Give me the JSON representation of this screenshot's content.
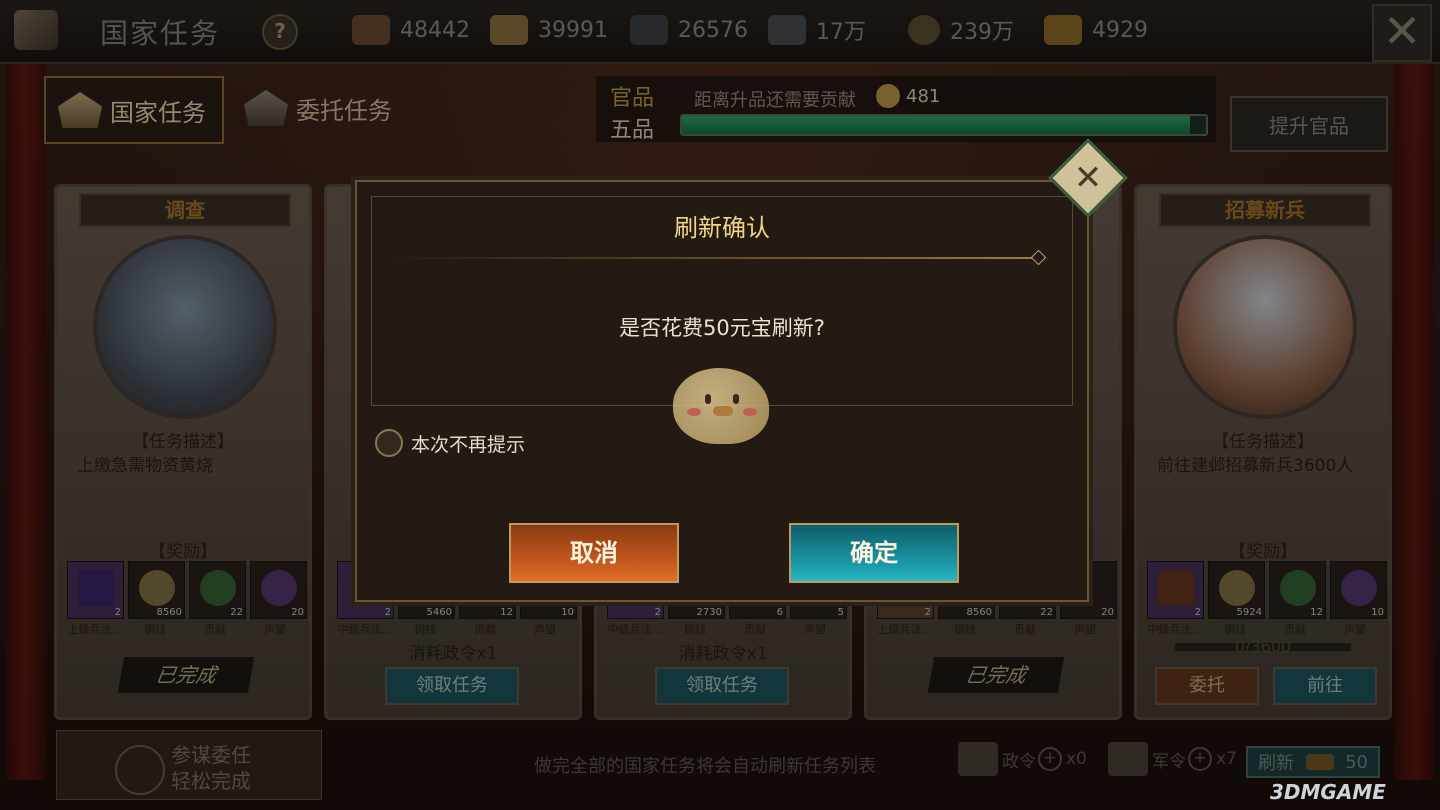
{
  "topbar": {
    "title": "国家任务",
    "help": "?",
    "resources": [
      {
        "icon": "wood-icon",
        "value": "48442"
      },
      {
        "icon": "grain-icon",
        "value": "39991"
      },
      {
        "icon": "iron-icon",
        "value": "26576"
      },
      {
        "icon": "stone-icon",
        "value": "17万"
      },
      {
        "icon": "copper-coin-icon",
        "value": "239万"
      },
      {
        "icon": "gold-ingot-icon",
        "value": "4929"
      }
    ],
    "close": "✕"
  },
  "tabs": [
    {
      "label": "国家任务",
      "active": true
    },
    {
      "label": "委托任务",
      "active": false
    }
  ],
  "rank": {
    "label": "官品",
    "value": "五品",
    "note": "距离升品还需要贡献",
    "remaining": "481",
    "progress": 0.97,
    "promote_label": "提升官品"
  },
  "cards": [
    {
      "title": "调查",
      "desc_header": "【任务描述】",
      "desc": "上缴急需物资黄烧",
      "reward_header": "【奖励】",
      "rewards": [
        {
          "n": "2",
          "label": "上级兵法…"
        },
        {
          "n": "8560",
          "label": "铜钱"
        },
        {
          "n": "22",
          "label": "贡献"
        },
        {
          "n": "20",
          "label": "声望"
        }
      ],
      "status": "已完成"
    },
    {
      "title": "",
      "desc_header": "",
      "desc": "",
      "reward_header": "",
      "rewards": [
        {
          "n": "2",
          "label": "中级兵法…"
        },
        {
          "n": "5460",
          "label": "铜钱"
        },
        {
          "n": "12",
          "label": "贡献"
        },
        {
          "n": "10",
          "label": "声望"
        }
      ],
      "cost": "消耗政令x1",
      "button": "领取任务"
    },
    {
      "title": "",
      "desc_header": "",
      "desc": "",
      "reward_header": "",
      "rewards": [
        {
          "n": "2",
          "label": "中级兵法…"
        },
        {
          "n": "2730",
          "label": "铜钱"
        },
        {
          "n": "6",
          "label": "贡献"
        },
        {
          "n": "5",
          "label": "声望"
        }
      ],
      "cost": "消耗政令x1",
      "button": "领取任务"
    },
    {
      "title": "",
      "desc_header": "",
      "desc": "",
      "reward_header": "",
      "rewards": [
        {
          "n": "2",
          "label": "上级兵法…"
        },
        {
          "n": "8560",
          "label": "铜钱"
        },
        {
          "n": "22",
          "label": "贡献"
        },
        {
          "n": "20",
          "label": "声望"
        }
      ],
      "status": "已完成"
    },
    {
      "title": "招募新兵",
      "desc_header": "【任务描述】",
      "desc": "前往建邺招募新兵3600人",
      "reward_header": "【奖励】",
      "rewards": [
        {
          "n": "2",
          "label": "中级兵法…"
        },
        {
          "n": "5924",
          "label": "铜钱"
        },
        {
          "n": "12",
          "label": "贡献"
        },
        {
          "n": "10",
          "label": "声望"
        }
      ],
      "progress": "0/3600",
      "button_left": "委托",
      "button_right": "前往"
    }
  ],
  "dialog": {
    "title": "刷新确认",
    "message": "是否花费50元宝刷新?",
    "checkbox_label": "本次不再提示",
    "cancel_label": "取消",
    "ok_label": "确定",
    "close": "✕"
  },
  "bottom": {
    "advisor_line1": "参谋委任",
    "advisor_line2": "轻松完成",
    "note": "做完全部的国家任务将会自动刷新任务列表",
    "token1_name": "政令",
    "token1_count": "x0",
    "token2_name": "军令",
    "token2_count": "x7",
    "refresh_label": "刷新",
    "refresh_cost": "50"
  },
  "watermark": "3DMGAME"
}
